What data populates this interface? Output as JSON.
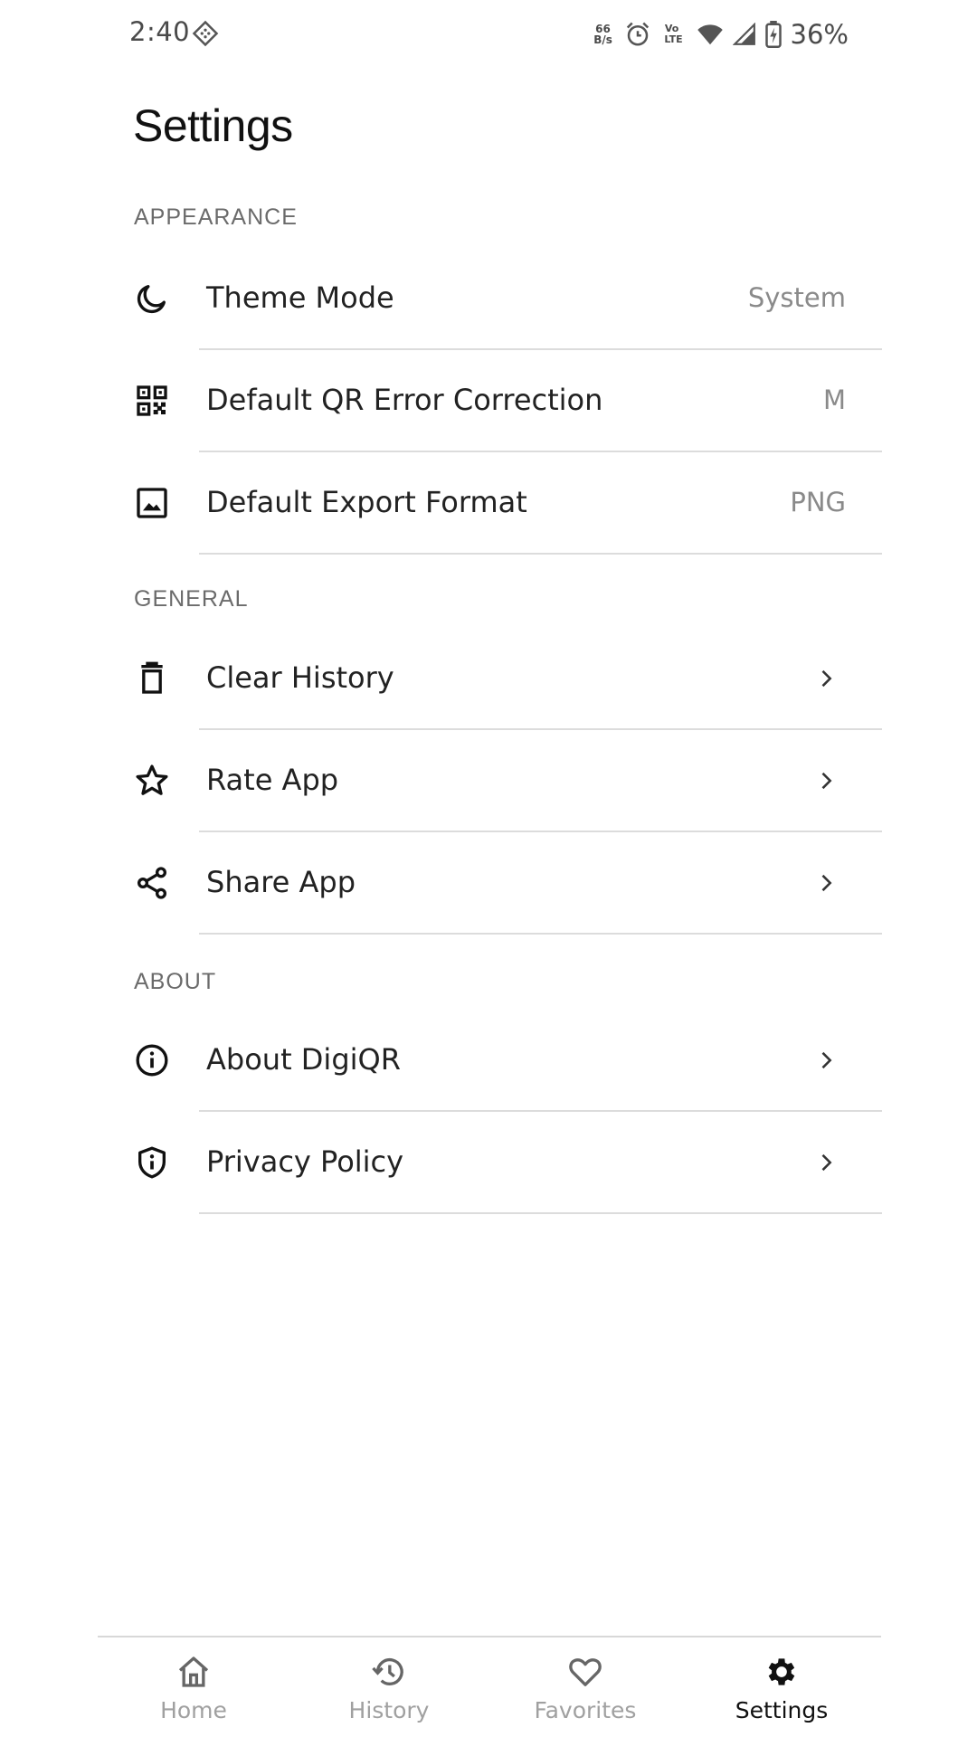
{
  "status_bar": {
    "time": "2:40",
    "net_speed": "66\nB/s",
    "volte": "Vo \nLTE",
    "battery_percent": "36%"
  },
  "page": {
    "title": "Settings"
  },
  "sections": {
    "appearance": {
      "header": "APPEARANCE",
      "items": [
        {
          "label": "Theme Mode",
          "value": "System",
          "icon": "moon-icon"
        },
        {
          "label": "Default QR Error Correction",
          "value": "M",
          "icon": "qr-code-icon"
        },
        {
          "label": "Default Export Format",
          "value": "PNG",
          "icon": "image-icon"
        }
      ]
    },
    "general": {
      "header": "GENERAL",
      "items": [
        {
          "label": "Clear History",
          "icon": "trash-icon"
        },
        {
          "label": "Rate App",
          "icon": "star-icon"
        },
        {
          "label": "Share App",
          "icon": "share-icon"
        }
      ]
    },
    "about": {
      "header": "ABOUT",
      "items": [
        {
          "label": "About DigiQR",
          "icon": "info-icon"
        },
        {
          "label": "Privacy Policy",
          "icon": "shield-info-icon"
        }
      ]
    }
  },
  "bottom_nav": {
    "items": [
      {
        "label": "Home",
        "icon": "home-icon",
        "active": false
      },
      {
        "label": "History",
        "icon": "history-icon",
        "active": false
      },
      {
        "label": "Favorites",
        "icon": "heart-icon",
        "active": false
      },
      {
        "label": "Settings",
        "icon": "gear-icon",
        "active": true
      }
    ]
  },
  "colors": {
    "background": "#ffffff",
    "text_primary": "#222222",
    "text_secondary": "#8a8a8a",
    "divider": "#dcdcdc",
    "nav_inactive": "#a0a0a0",
    "nav_active": "#111111"
  }
}
